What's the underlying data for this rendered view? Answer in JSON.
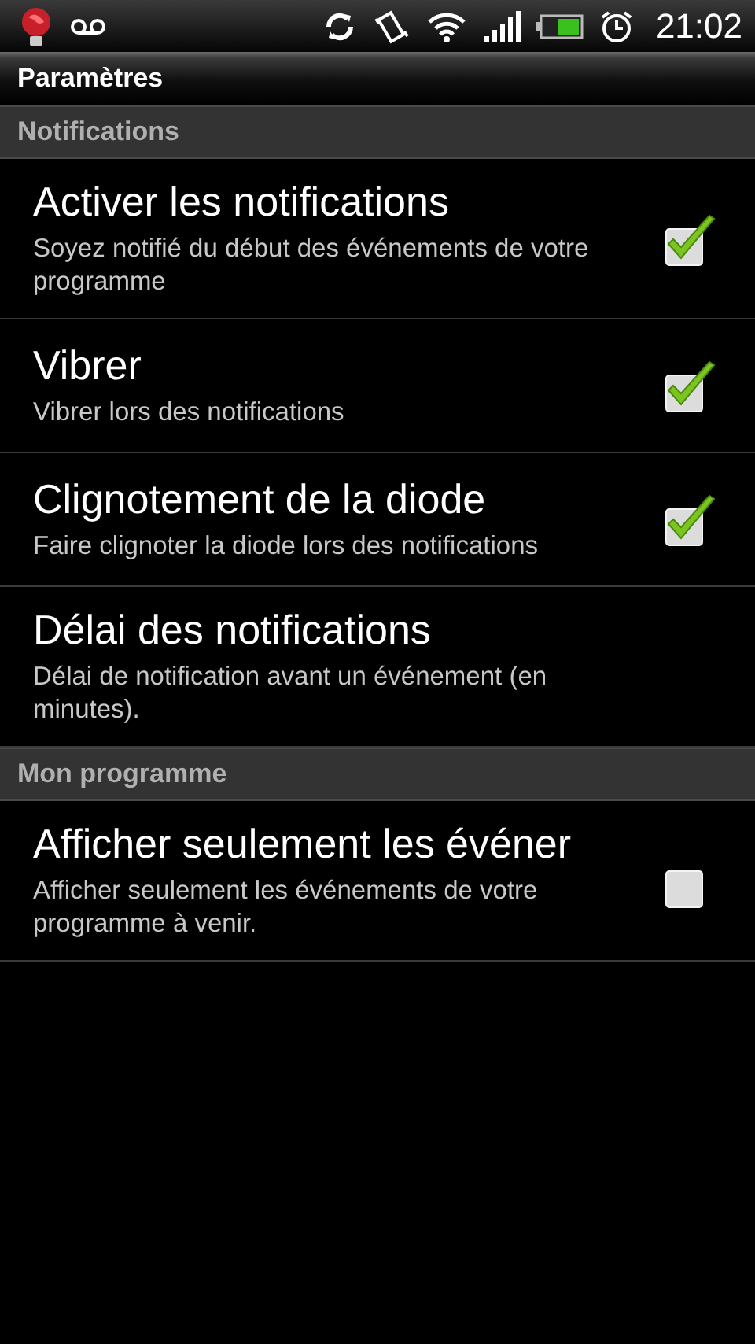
{
  "status_bar": {
    "time": "21:02"
  },
  "title": "Paramètres",
  "sections": [
    {
      "header": "Notifications",
      "items": [
        {
          "kind": "checkbox",
          "title": "Activer les notifications",
          "summary": "Soyez notifié du début des événements de votre programme",
          "checked": true
        },
        {
          "kind": "checkbox",
          "title": "Vibrer",
          "summary": "Vibrer lors des notifications",
          "checked": true
        },
        {
          "kind": "checkbox",
          "title": "Clignotement de la diode",
          "summary": "Faire clignoter la diode lors des notifications",
          "checked": true
        },
        {
          "kind": "plain",
          "title": "Délai des notifications",
          "summary": "Délai de notification avant un événement (en minutes)."
        }
      ]
    },
    {
      "header": "Mon programme",
      "items": [
        {
          "kind": "checkbox",
          "title": "Afficher seulement les événer",
          "summary": "Afficher seulement les événements de votre programme à venir.",
          "checked": false
        }
      ]
    }
  ]
}
